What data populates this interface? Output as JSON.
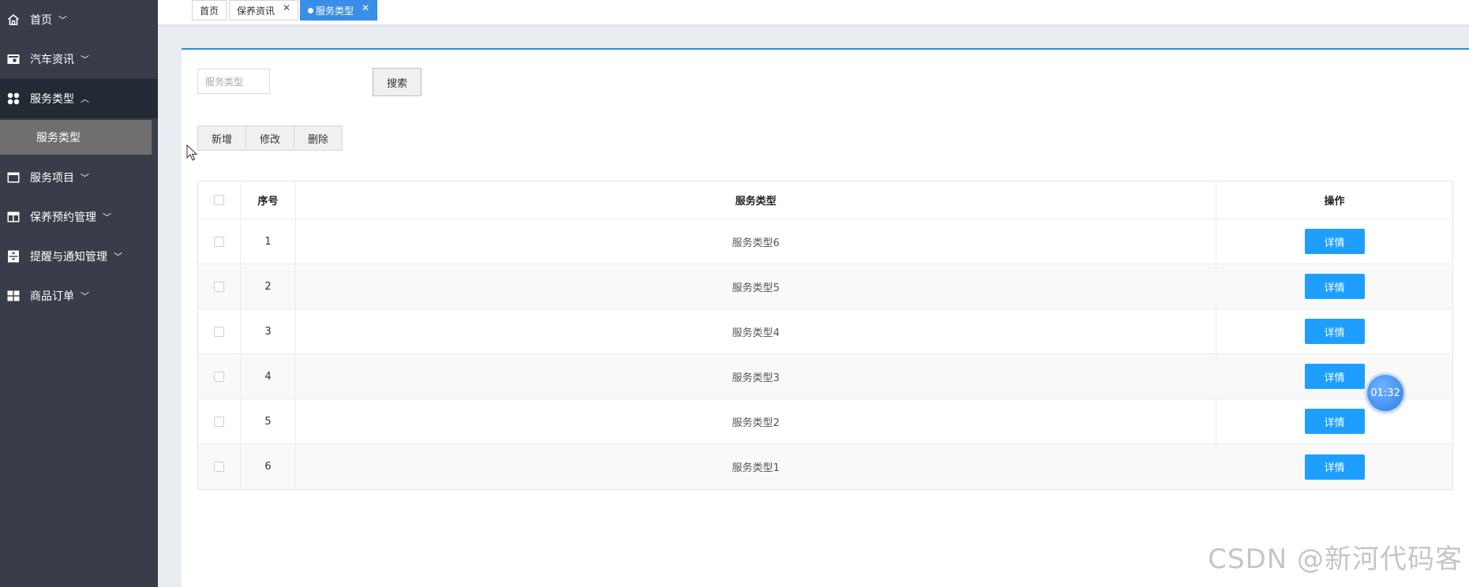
{
  "sidebar": {
    "items": [
      {
        "label": "首页",
        "icon": "home-icon",
        "expanded": false
      },
      {
        "label": "汽车资讯",
        "icon": "news-icon",
        "expanded": false
      },
      {
        "label": "服务类型",
        "icon": "apps-icon",
        "expanded": true,
        "children": [
          {
            "label": "服务类型",
            "active": true
          }
        ]
      },
      {
        "label": "服务项目",
        "icon": "window-icon",
        "expanded": false
      },
      {
        "label": "保养预约管理",
        "icon": "layout-icon",
        "expanded": false
      },
      {
        "label": "提醒与通知管理",
        "icon": "cabinet-icon",
        "expanded": false
      },
      {
        "label": "商品订单",
        "icon": "grid-icon",
        "expanded": false
      }
    ]
  },
  "tabs": [
    {
      "label": "首页",
      "closable": false,
      "active": false
    },
    {
      "label": "保养资讯",
      "closable": true,
      "active": false
    },
    {
      "label": "服务类型",
      "closable": true,
      "active": true
    }
  ],
  "search": {
    "placeholder": "服务类型",
    "button_label": "搜索"
  },
  "actions": {
    "add": "新增",
    "edit": "修改",
    "delete": "删除"
  },
  "table": {
    "headers": {
      "no": "序号",
      "type": "服务类型",
      "op": "操作"
    },
    "rows": [
      {
        "no": "1",
        "type": "服务类型6",
        "op": "详情"
      },
      {
        "no": "2",
        "type": "服务类型5",
        "op": "详情"
      },
      {
        "no": "3",
        "type": "服务类型4",
        "op": "详情"
      },
      {
        "no": "4",
        "type": "服务类型3",
        "op": "详情"
      },
      {
        "no": "5",
        "type": "服务类型2",
        "op": "详情"
      },
      {
        "no": "6",
        "type": "服务类型1",
        "op": "详情"
      }
    ]
  },
  "timer": {
    "text": "01:32"
  },
  "watermark": "CSDN @新河代码客",
  "colors": {
    "sidebar": "#393d49",
    "accent": "#1e9fff",
    "active_tab": "#3a8ee6",
    "card_border": "#2f8fd8"
  }
}
